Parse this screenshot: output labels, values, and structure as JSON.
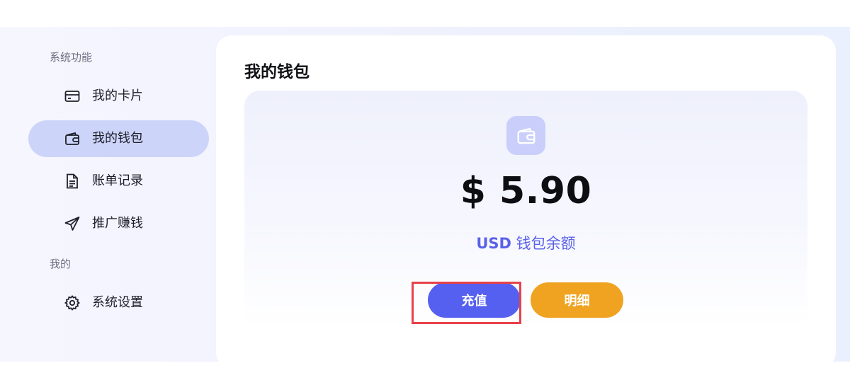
{
  "sidebar": {
    "section_system": "系统功能",
    "section_mine": "我的",
    "items": [
      {
        "label": "我的卡片",
        "icon": "card-icon"
      },
      {
        "label": "我的钱包",
        "icon": "wallet-icon",
        "active": true
      },
      {
        "label": "账单记录",
        "icon": "document-icon"
      },
      {
        "label": "推广赚钱",
        "icon": "paper-plane-icon"
      },
      {
        "label": "系统设置",
        "icon": "gear-icon"
      }
    ]
  },
  "main": {
    "title": "我的钱包",
    "wallet": {
      "icon": "wallet-icon",
      "balance": "$ 5.90",
      "currency": "USD",
      "balance_label": "钱包余额",
      "recharge_label": "充值",
      "detail_label": "明细"
    }
  },
  "colors": {
    "accent": "#5660f0",
    "detail_button": "#efa320",
    "active_nav": "#cdd4f9",
    "highlight": "#e8414a"
  }
}
